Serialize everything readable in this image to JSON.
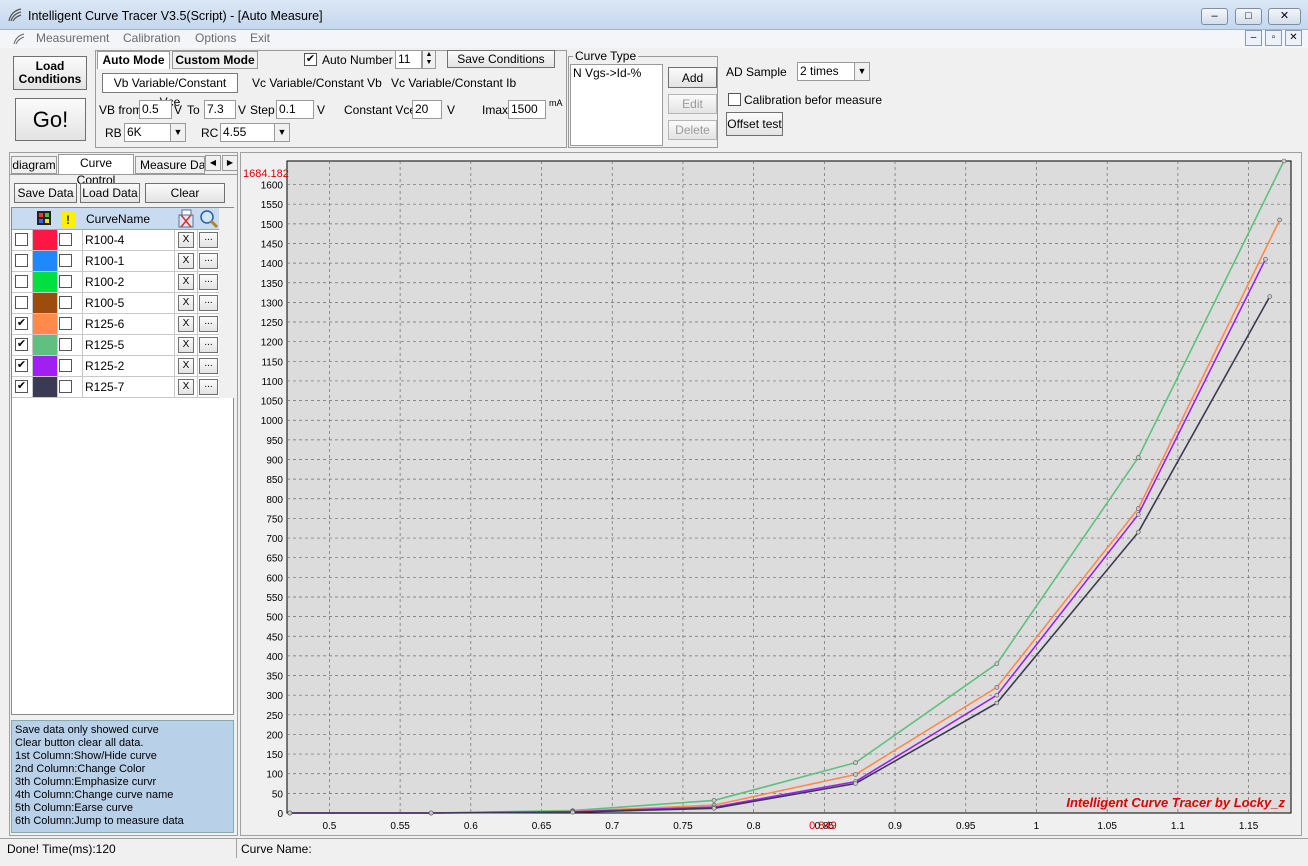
{
  "window": {
    "title": "Intelligent Curve Tracer V3.5(Script) - [Auto Measure]",
    "minimize": "–",
    "maximize": "□",
    "close": "✕"
  },
  "menu": [
    "Measurement",
    "Calibration",
    "Options",
    "Exit"
  ],
  "toolbar": {
    "load_conditions": "Load Conditions",
    "go": "Go!",
    "mode_tabs": [
      "Auto Mode",
      "Custom Mode"
    ],
    "sub_tabs": [
      "Vb Variable/Constant Vce",
      "Vc Variable/Constant Vb",
      "Vc Variable/Constant Ib"
    ],
    "vb_from_label": "VB from",
    "vb_from_value": "0.5",
    "v_unit": "V",
    "to_label": "To",
    "to_value": "7.3",
    "step_label": "Step",
    "step_value": "0.1",
    "constant_vce_label": "Constant Vce",
    "constant_vce_value": "20",
    "imax_label": "Imax",
    "imax_value": "1500",
    "imax_unit": "mA",
    "rb_label": "RB",
    "rb_value": "6K",
    "rc_label": "RC",
    "rc_value": "4.55",
    "auto_number_label": "Auto Number",
    "auto_number_checked": "✔",
    "auto_number_value": "11",
    "save_conditions": "Save Conditions",
    "curve_type_label": "Curve Type",
    "curve_type_item": "N Vgs->Id-%",
    "add": "Add",
    "edit": "Edit",
    "delete": "Delete",
    "ad_sample_label": "AD Sample",
    "ad_sample_value": "2 times",
    "calibration_label": "Calibration befor measure",
    "offset_test": "Offset test"
  },
  "left_tabs": [
    "diagram",
    "Curve Control",
    "Measure Data"
  ],
  "left_buttons": {
    "save": "Save Data",
    "load": "Load Data",
    "clear": "Clear"
  },
  "curve_table": {
    "header_name": "CurveName",
    "erase_label": "X",
    "jump_label": "...",
    "check_mark": "✔",
    "rows": [
      {
        "show": false,
        "color": "#ff1744",
        "name": "R100-4"
      },
      {
        "show": false,
        "color": "#1e88ff",
        "name": "R100-1"
      },
      {
        "show": false,
        "color": "#00e040",
        "name": "R100-2"
      },
      {
        "show": false,
        "color": "#9c4c0c",
        "name": "R100-5"
      },
      {
        "show": true,
        "color": "#ff8a4c",
        "name": "R125-6"
      },
      {
        "show": true,
        "color": "#60c080",
        "name": "R125-5"
      },
      {
        "show": true,
        "color": "#a020f0",
        "name": "R125-2"
      },
      {
        "show": true,
        "color": "#3a3a54",
        "name": "R125-7"
      }
    ]
  },
  "help": [
    "  Save data only showed curve",
    "  Clear button clear all data.",
    "1st Column:Show/Hide curve",
    "2nd Column:Change Color",
    "3th Column:Emphasize curvr",
    "4th Column:Change curve name",
    "5th Column:Earse curve",
    "6th Column:Jump to measure data"
  ],
  "status": {
    "left": "Done!  Time(ms):120",
    "right": "Curve Name:"
  },
  "chart_data": {
    "type": "line",
    "title": "",
    "xlabel": "",
    "ylabel": "",
    "xlim": [
      0.47,
      1.18
    ],
    "ylim": [
      0,
      1660
    ],
    "x_ticks": [
      "0.5",
      "0.55",
      "0.6",
      "0.65",
      "0.7",
      "0.75",
      "0.8",
      "0.85",
      "0.9",
      "0.95",
      "1",
      "1.05",
      "1.1",
      "1.15"
    ],
    "x_tick_values": [
      0.5,
      0.55,
      0.6,
      0.65,
      0.7,
      0.75,
      0.8,
      0.85,
      0.9,
      0.95,
      1.0,
      1.05,
      1.1,
      1.15
    ],
    "y_ticks": [
      "0",
      "50",
      "100",
      "150",
      "200",
      "250",
      "300",
      "350",
      "400",
      "450",
      "500",
      "550",
      "600",
      "650",
      "700",
      "750",
      "800",
      "850",
      "900",
      "950",
      "1000",
      "1050",
      "1100",
      "1150",
      "1200",
      "1250",
      "1300",
      "1350",
      "1400",
      "1450",
      "1500",
      "1550",
      "1600"
    ],
    "y_tick_values": [
      0,
      50,
      100,
      150,
      200,
      250,
      300,
      350,
      400,
      450,
      500,
      550,
      600,
      650,
      700,
      750,
      800,
      850,
      900,
      950,
      1000,
      1050,
      1100,
      1150,
      1200,
      1250,
      1300,
      1350,
      1400,
      1450,
      1500,
      1550,
      1600
    ],
    "cursor_x_label": "0.849",
    "cursor_x_value": 0.849,
    "cursor_y_label": "1684.182",
    "grid": true,
    "watermark": "Intelligent Curve Tracer by Locky_z",
    "series": [
      {
        "color": "#60c080",
        "x": [
          0.472,
          0.572,
          0.672,
          0.772,
          0.872,
          0.972,
          1.072,
          1.175
        ],
        "y": [
          0,
          0,
          6,
          32,
          128,
          380,
          905,
          1660
        ]
      },
      {
        "color": "#ff8a4c",
        "x": [
          0.472,
          0.572,
          0.672,
          0.772,
          0.872,
          0.972,
          1.072,
          1.172
        ],
        "y": [
          0,
          0,
          4,
          20,
          98,
          320,
          775,
          1510
        ]
      },
      {
        "color": "#a020f0",
        "x": [
          0.472,
          0.572,
          0.672,
          0.772,
          0.872,
          0.972,
          1.072,
          1.162
        ],
        "y": [
          0,
          0,
          3,
          15,
          80,
          300,
          760,
          1410
        ]
      },
      {
        "color": "#3a3a54",
        "x": [
          0.472,
          0.572,
          0.672,
          0.772,
          0.872,
          0.972,
          1.072,
          1.165
        ],
        "y": [
          0,
          0,
          2,
          12,
          75,
          280,
          715,
          1315
        ]
      }
    ]
  }
}
